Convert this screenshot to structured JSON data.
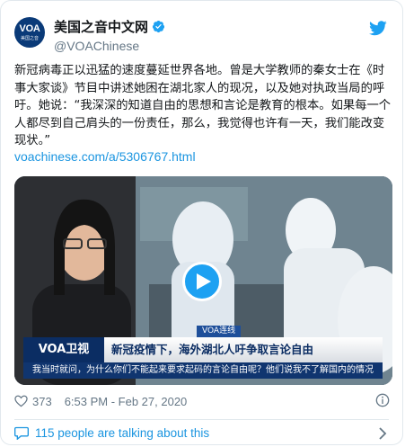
{
  "tweet": {
    "account": {
      "display_name": "美国之音中文网",
      "handle": "@VOAChinese",
      "avatar_logo": "VOA",
      "avatar_subtext": "美国之音",
      "verified_icon": "verified-badge-icon",
      "brand_icon": "twitter-bird-icon"
    },
    "text": "新冠病毒正以迅猛的速度蔓延世界各地。曾是大学教师的秦女士在《时事大家谈》节目中讲述她困在湖北家人的现况，以及她对执政当局的呼吁。她说：“我深深的知道自由的思想和言论是教育的根本。如果每一个人都尽到自己肩头的一份责任，那么，我觉得也许有一天，我们能改变现状。”",
    "link": "voachinese.com/a/5306767.html",
    "media": {
      "type": "video",
      "play_icon": "play-icon",
      "kicker": "VOA连线",
      "channel": "VOA卫视",
      "headline": "新冠疫情下，海外湖北人吁争取言论自由",
      "subtitle": "我当时就问，为什么你们不能起来要求起码的言论自由呢？他们说我不了解国内的情况"
    },
    "likes": "373",
    "timestamp": "6:53 PM - Feb 27, 2020",
    "conversation": "115 people are talking about this"
  },
  "colors": {
    "link": "#1b95e0",
    "twitter_blue": "#1da1f2",
    "secondary_text": "#657786",
    "border": "#e1e8ed",
    "voa_navy": "#0b2d63"
  }
}
